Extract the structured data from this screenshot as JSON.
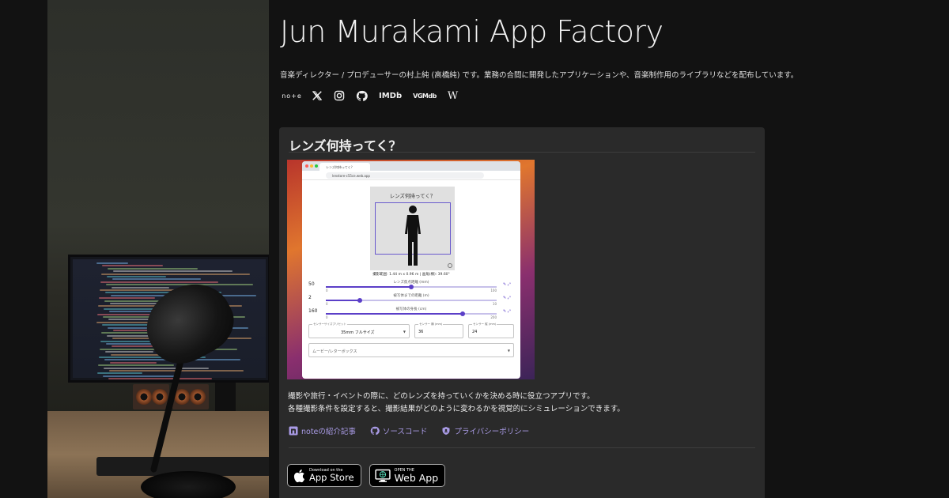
{
  "site": {
    "title": "Jun Murakami App Factory",
    "description": "音楽ディレクター / プロデューサーの村上純 (高橋純) です。業務の合間に開発したアプリケーションや、音楽制作用のライブラリなどを配布しています。"
  },
  "social": [
    {
      "name": "note",
      "label": "no+e"
    },
    {
      "name": "x",
      "label": ""
    },
    {
      "name": "instagram",
      "label": ""
    },
    {
      "name": "github",
      "label": ""
    },
    {
      "name": "imdb",
      "label": "IMDb"
    },
    {
      "name": "vgmdb",
      "label": "VGMdb"
    },
    {
      "name": "wikipedia",
      "label": "W"
    }
  ],
  "app_card": {
    "title": "レンズ何持ってく？",
    "description_lines": [
      "撮影や旅行・イベントの際に、どのレンズを持っていくかを決める時に役立つアプリです。",
      "各種撮影条件を設定すると、撮影結果がどのように変わるかを視覚的にシミュレーションできます。"
    ],
    "links": [
      {
        "label": "noteの紹介記事",
        "icon": "note-icon"
      },
      {
        "label": "ソースコード",
        "icon": "github-icon"
      },
      {
        "label": "プライバシーポリシー",
        "icon": "shield-icon"
      }
    ],
    "store_badges": {
      "appstore": {
        "small": "Download on the",
        "big": "App Store"
      },
      "webapp": {
        "small": "OPEN THE",
        "big": "Web App"
      }
    }
  },
  "screenshot": {
    "tab_title": "レンズ何持ってく？",
    "url": "lenstore-c55ce.web.app",
    "view_title": "レンズ何持ってく？",
    "caption": "撮影範囲: 1.44 m x 0.96 m | 画角(横): 39.60°",
    "sliders": [
      {
        "label": "レンズ焦点距離 (mm)",
        "value": "50",
        "min": "0",
        "max": "100",
        "fraction": 0.5
      },
      {
        "label": "被写体までの距離 (m)",
        "value": "2",
        "min": "0",
        "max": "10",
        "fraction": 0.2
      },
      {
        "label": "被写体の身長 (cm)",
        "value": "160",
        "min": "0",
        "max": "200",
        "fraction": 0.8
      }
    ],
    "fields": {
      "preset_label": "センサーサイズプリセット",
      "preset_value": "35mm フルサイズ",
      "width_label": "センサー 横 (mm)",
      "width_value": "36",
      "height_label": "センサー 縦 (mm)",
      "height_value": "24",
      "mode_value": "ムービー/レターボックス"
    }
  },
  "colors": {
    "background": "#121212",
    "card": "#2a2a2a",
    "accent_link": "#a99be6",
    "slider": "#5b3fc8"
  }
}
